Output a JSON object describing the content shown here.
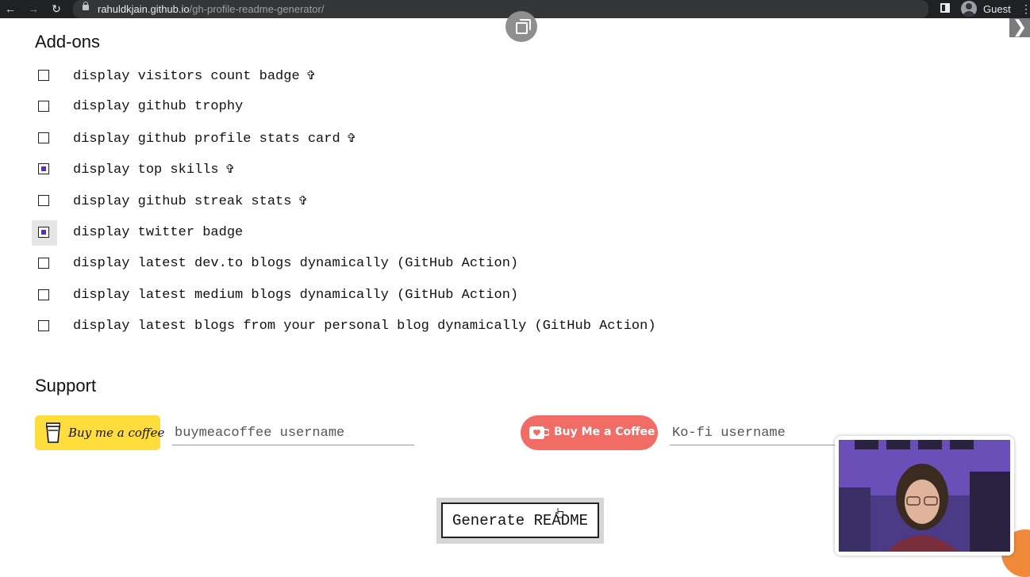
{
  "browser": {
    "url_host": "rahuldkjain.github.io",
    "url_path": "/gh-profile-readme-generator/",
    "profile_label": "Guest",
    "icons": [
      "back-arrow-icon",
      "forward-arrow-icon",
      "reload-icon",
      "lock-icon",
      "side-panel-icon",
      "profile-avatar-icon",
      "more-menu-icon"
    ]
  },
  "addons": {
    "heading": "Add-ons",
    "items": [
      {
        "label": "display visitors count badge",
        "checked": false,
        "extra": "settings-icon"
      },
      {
        "label": "display github trophy",
        "checked": false
      },
      {
        "label": "display github profile stats card",
        "checked": false,
        "extra": "settings-icon"
      },
      {
        "label": "display top skills",
        "checked": true,
        "extra": "settings-icon"
      },
      {
        "label": "display github streak stats",
        "checked": false,
        "extra": "settings-icon"
      },
      {
        "label": "display twitter badge",
        "checked": true
      },
      {
        "label": "display latest dev.to blogs dynamically (GitHub Action)",
        "checked": false
      },
      {
        "label": "display latest medium blogs dynamically (GitHub Action)",
        "checked": false
      },
      {
        "label": "display latest blogs from your personal blog dynamically (GitHub Action)",
        "checked": false
      }
    ]
  },
  "support": {
    "heading": "Support",
    "bmc_button_label": "Buy me a coffee",
    "bmc_placeholder": "buymeacoffee username",
    "kofi_button_label": "Buy Me a Coffee",
    "kofi_placeholder": "Ko-fi username"
  },
  "generate_label": "Generate README",
  "colors": {
    "checkbox_accent": "#5b2fb0",
    "bmc_yellow": "#ffdd3c",
    "kofi_red": "#f06c64",
    "browser_bar": "#202124"
  }
}
